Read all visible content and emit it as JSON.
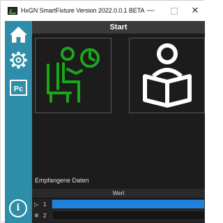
{
  "window": {
    "title": "HxGN SmartFixture  Version 2022.0.0.1 BETA",
    "controls": {
      "minimize": "—",
      "close": "✕"
    }
  },
  "sidebar": {
    "items": [
      {
        "name": "home",
        "icon": "home-icon"
      },
      {
        "name": "settings",
        "icon": "gear-icon"
      },
      {
        "name": "pc",
        "icon": "pc-icon",
        "label": "Pc"
      }
    ],
    "info": {
      "icon": "info-icon",
      "label": "i"
    }
  },
  "main": {
    "header": "Start",
    "tiles": [
      {
        "name": "sitting-person-clock",
        "icon": "sitting-person-clock-icon",
        "color": "#1aa81a"
      },
      {
        "name": "reading-person",
        "icon": "reading-person-icon",
        "color": "#ffffff"
      }
    ],
    "received_label": "Empfangene Daten",
    "grid": {
      "column": "Wert",
      "rows": [
        {
          "indicator": "▷",
          "number": "1",
          "selected": true
        },
        {
          "indicator": "✲",
          "number": "2",
          "selected": false
        }
      ]
    }
  },
  "colors": {
    "sidebar": "#2e8da8",
    "content_bg": "#1c1c1c",
    "header_bg": "#3a3a3a",
    "selected_row": "#1f82e0"
  }
}
